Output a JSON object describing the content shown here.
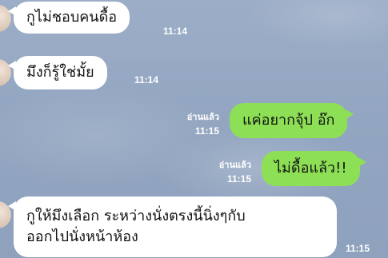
{
  "chat": {
    "messages": [
      {
        "id": "m1",
        "direction": "incoming",
        "text": "กูไม่ชอบคนดื้อ",
        "time": "11:14"
      },
      {
        "id": "m2",
        "direction": "incoming",
        "text": "มึงก็รู้ใช่มั้ย",
        "time": "11:14"
      },
      {
        "id": "m3",
        "direction": "outgoing",
        "text": "แค่อยากจุ้ป อ๊ก",
        "time": "11:15",
        "status": "อ่านแล้ว"
      },
      {
        "id": "m4",
        "direction": "outgoing",
        "text": "ไม่ดื้อแล้ว!!",
        "time": "11:15",
        "status": "อ่านแล้ว"
      },
      {
        "id": "m5",
        "direction": "incoming",
        "line1": "กูให้มึงเลือก ระหว่างนั่งตรงนี้นิ่งๆกับ",
        "line2": "ออกไปนั่งหน้าห้อง",
        "time": "11:15"
      }
    ]
  },
  "colors": {
    "incoming_bubble": "#ffffff",
    "outgoing_bubble": "#8de055",
    "background": "#97a9c3"
  }
}
